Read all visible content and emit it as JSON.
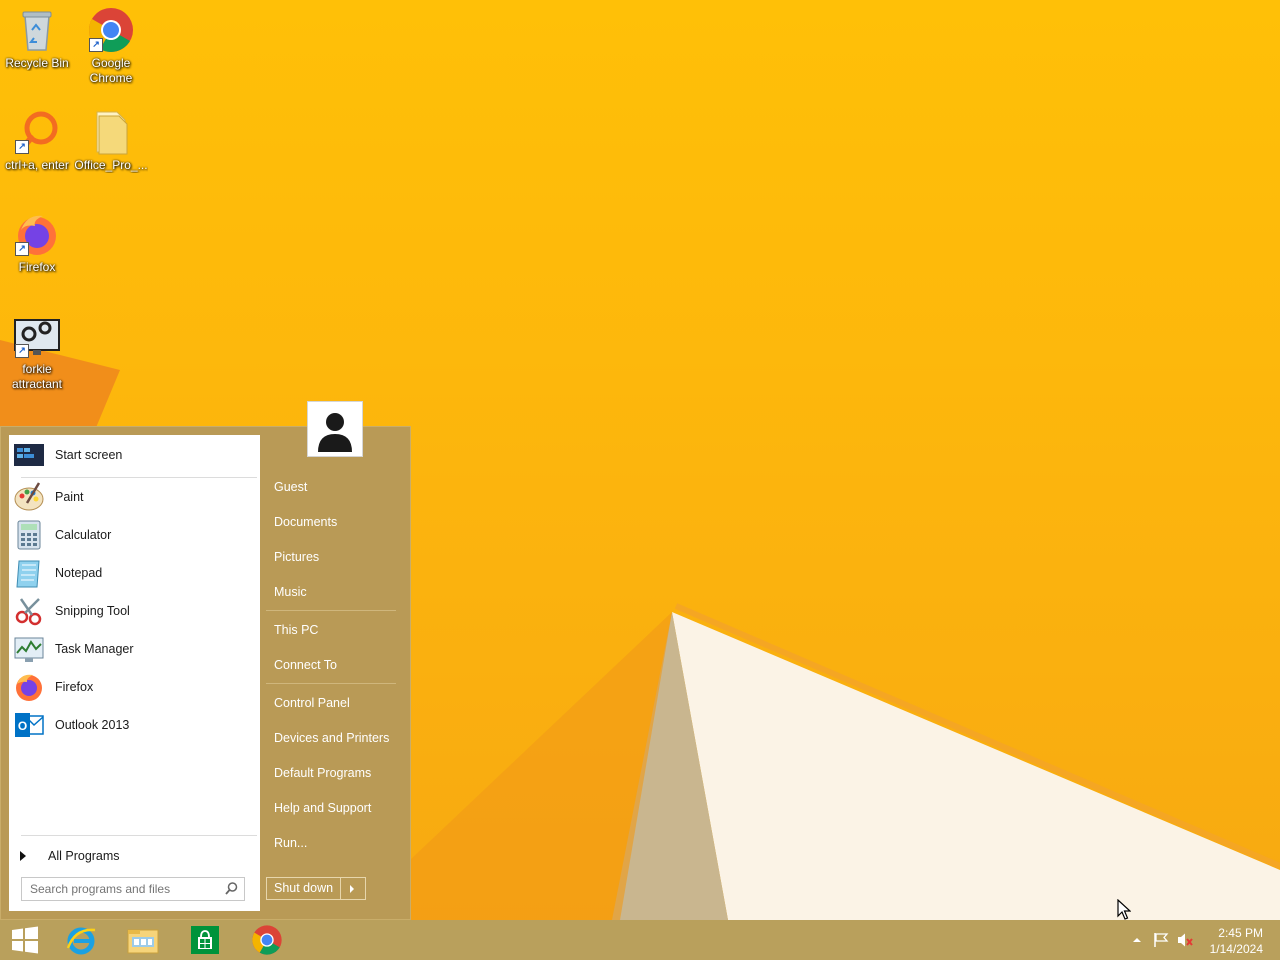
{
  "desktop": {
    "icons": [
      {
        "label": "Recycle Bin",
        "icon": "recycle-bin-icon"
      },
      {
        "label": "Google\nChrome",
        "icon": "chrome-icon"
      },
      {
        "label": "ctrl+a, enter",
        "icon": "search-magnifier-icon"
      },
      {
        "label": "Office_Pro_...",
        "icon": "folder-icon"
      },
      {
        "label": "Firefox",
        "icon": "firefox-icon"
      },
      {
        "label": "forkie\nattractant",
        "icon": "settings-monitor-icon"
      }
    ]
  },
  "start_menu": {
    "programs": [
      {
        "label": "Start screen",
        "icon": "start-screen-icon"
      },
      {
        "label": "Paint",
        "icon": "paint-icon"
      },
      {
        "label": "Calculator",
        "icon": "calculator-icon"
      },
      {
        "label": "Notepad",
        "icon": "notepad-icon"
      },
      {
        "label": "Snipping Tool",
        "icon": "snipping-tool-icon"
      },
      {
        "label": "Task Manager",
        "icon": "task-manager-icon"
      },
      {
        "label": "Firefox",
        "icon": "firefox-icon"
      },
      {
        "label": "Outlook 2013",
        "icon": "outlook-icon"
      }
    ],
    "all_programs": "All Programs",
    "search_placeholder": "Search programs and files",
    "right_items": {
      "guest": "Guest",
      "documents": "Documents",
      "pictures": "Pictures",
      "music": "Music",
      "this_pc": "This PC",
      "connect_to": "Connect To",
      "control_panel": "Control Panel",
      "devices_printers": "Devices and Printers",
      "default_programs": "Default Programs",
      "help_support": "Help and Support",
      "run": "Run..."
    },
    "shutdown_label": "Shut down"
  },
  "taskbar": {
    "apps": [
      "start-button-icon",
      "internet-explorer-icon",
      "file-explorer-icon",
      "store-icon",
      "chrome-icon"
    ],
    "tray": [
      "show-hidden-icons-icon",
      "action-center-flag-icon",
      "speaker-muted-icon"
    ],
    "time": "2:45 PM",
    "date": "1/14/2024"
  },
  "colors": {
    "wallpaper": "#fdb70c",
    "start_menu_bg": "#b99a56",
    "taskbar_bg": "#b9a05c"
  }
}
